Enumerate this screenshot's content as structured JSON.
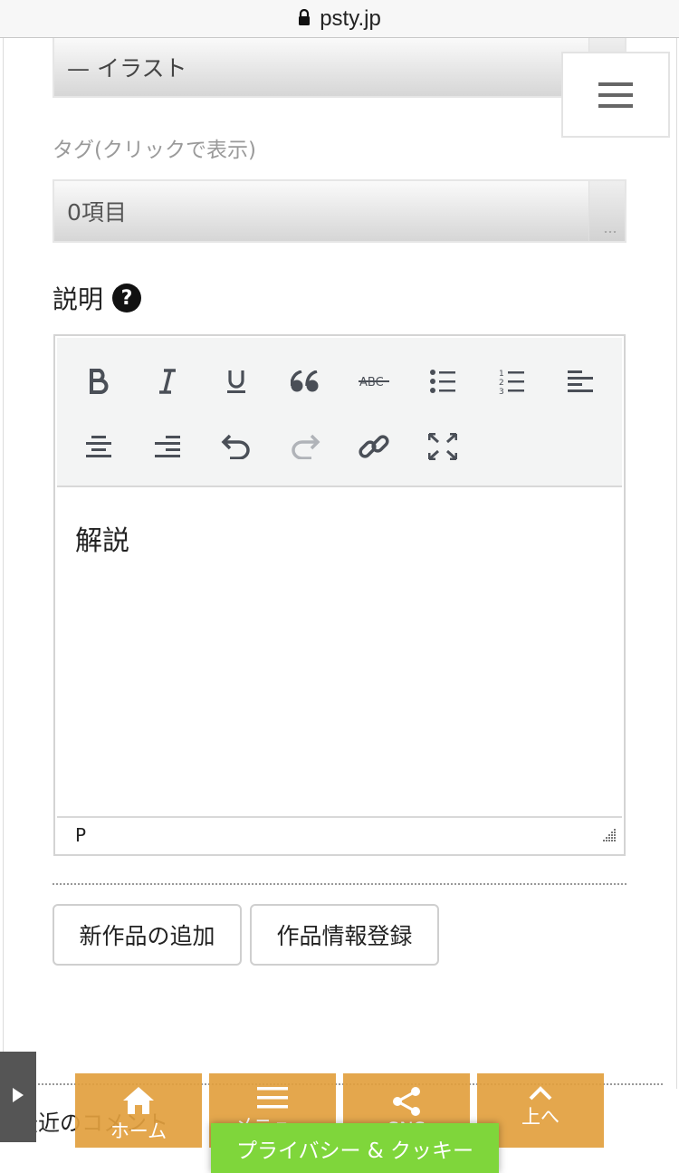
{
  "browser": {
    "url": "psty.jp"
  },
  "form": {
    "category_value": "— イラスト",
    "tag_label": "タグ(クリックで表示)",
    "tag_value": "0項目",
    "description_label": "説明",
    "help_symbol": "?"
  },
  "editor": {
    "toolbar_icons": [
      "bold-icon",
      "italic-icon",
      "underline-icon",
      "blockquote-icon",
      "strikethrough-icon",
      "bullet-list-icon",
      "numbered-list-icon",
      "align-left-icon",
      "align-center-icon",
      "align-right-icon",
      "undo-icon",
      "redo-icon",
      "link-icon",
      "fullscreen-icon"
    ],
    "content": "解説",
    "status_path": "P"
  },
  "actions": {
    "add_new_label": "新作品の追加",
    "register_label": "作品情報登録"
  },
  "footer": {
    "recent_comments": "最近のコメント",
    "nav": {
      "home": "ホーム",
      "menu": "メニュー",
      "sns": "SNS",
      "top": "上へ"
    },
    "privacy": "プライバシー & クッキー"
  },
  "colors": {
    "nav_orange": "#e2a03e",
    "privacy_green": "#7fd63b",
    "icon_dark": "#4a4f57"
  }
}
